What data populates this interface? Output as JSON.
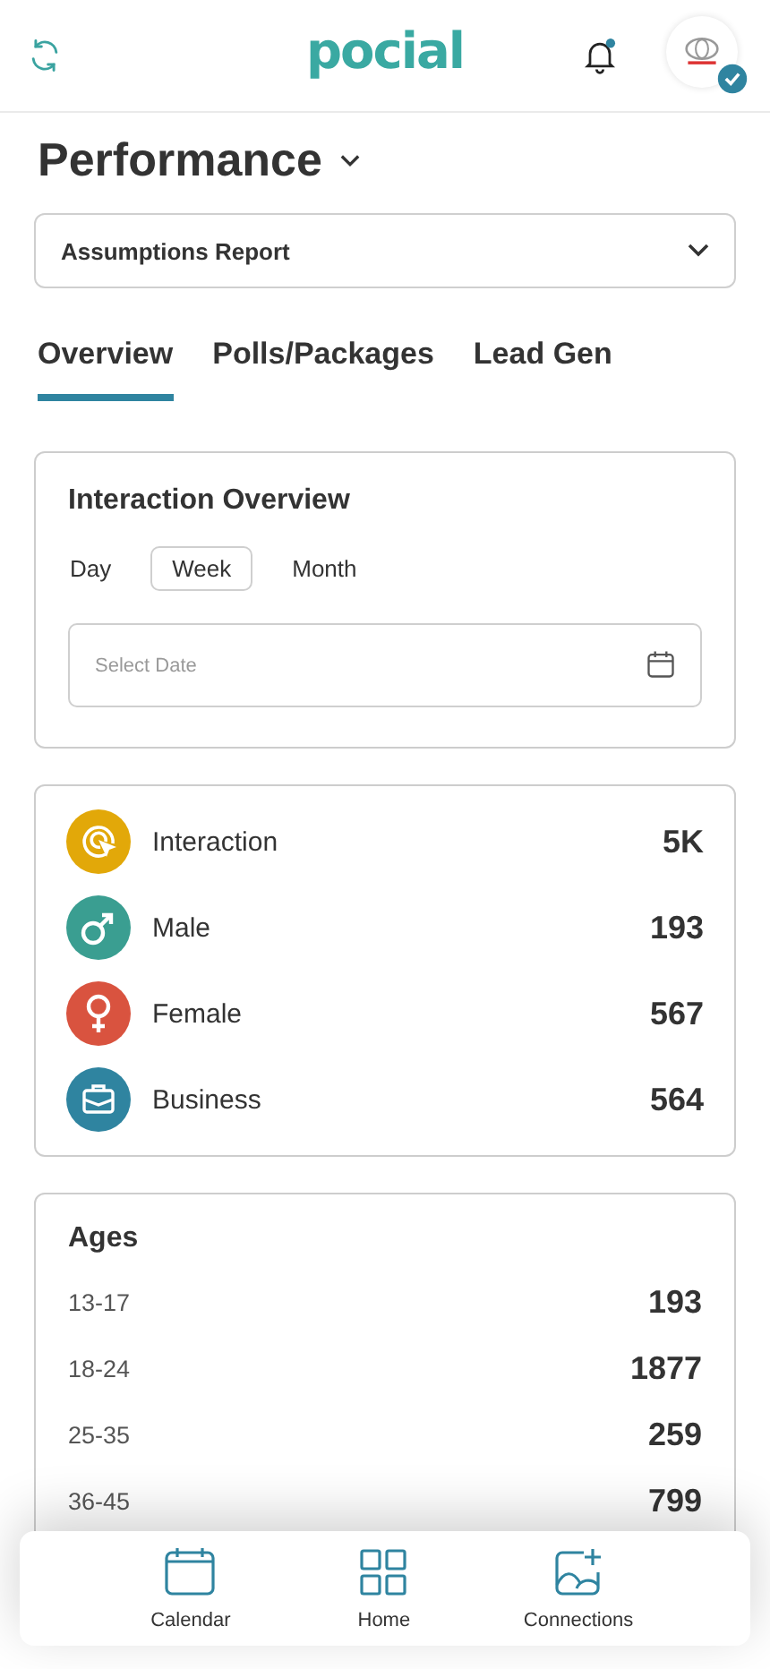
{
  "header": {
    "logo": "pocial",
    "has_notification": true,
    "verified": true
  },
  "page_title": "Performance",
  "report_select": {
    "value": "Assumptions Report"
  },
  "tabs": [
    {
      "label": "Overview",
      "selected": true
    },
    {
      "label": "Polls/Packages",
      "selected": false
    },
    {
      "label": "Lead Gen",
      "selected": false
    }
  ],
  "interaction_overview": {
    "title": "Interaction Overview",
    "periods": [
      {
        "label": "Day",
        "selected": false
      },
      {
        "label": "Week",
        "selected": true
      },
      {
        "label": "Month",
        "selected": false
      }
    ],
    "date_field": {
      "placeholder": "Select Date"
    }
  },
  "stats": [
    {
      "kind": "interaction",
      "label": "Interaction",
      "value": "5K",
      "color": "#e2a809"
    },
    {
      "kind": "male",
      "label": "Male",
      "value": "193",
      "color": "#3a9e91"
    },
    {
      "kind": "female",
      "label": "Female",
      "value": "567",
      "color": "#d9533f"
    },
    {
      "kind": "business",
      "label": "Business",
      "value": "564",
      "color": "#2f84a0"
    }
  ],
  "ages": {
    "title": "Ages",
    "rows": [
      {
        "label": "13-17",
        "value": "193"
      },
      {
        "label": "18-24",
        "value": "1877"
      },
      {
        "label": "25-35",
        "value": "259"
      },
      {
        "label": "36-45",
        "value": "799"
      }
    ]
  },
  "bottom_nav": [
    {
      "kind": "calendar",
      "label": "Calendar"
    },
    {
      "kind": "home",
      "label": "Home"
    },
    {
      "kind": "connections",
      "label": "Connections"
    }
  ]
}
